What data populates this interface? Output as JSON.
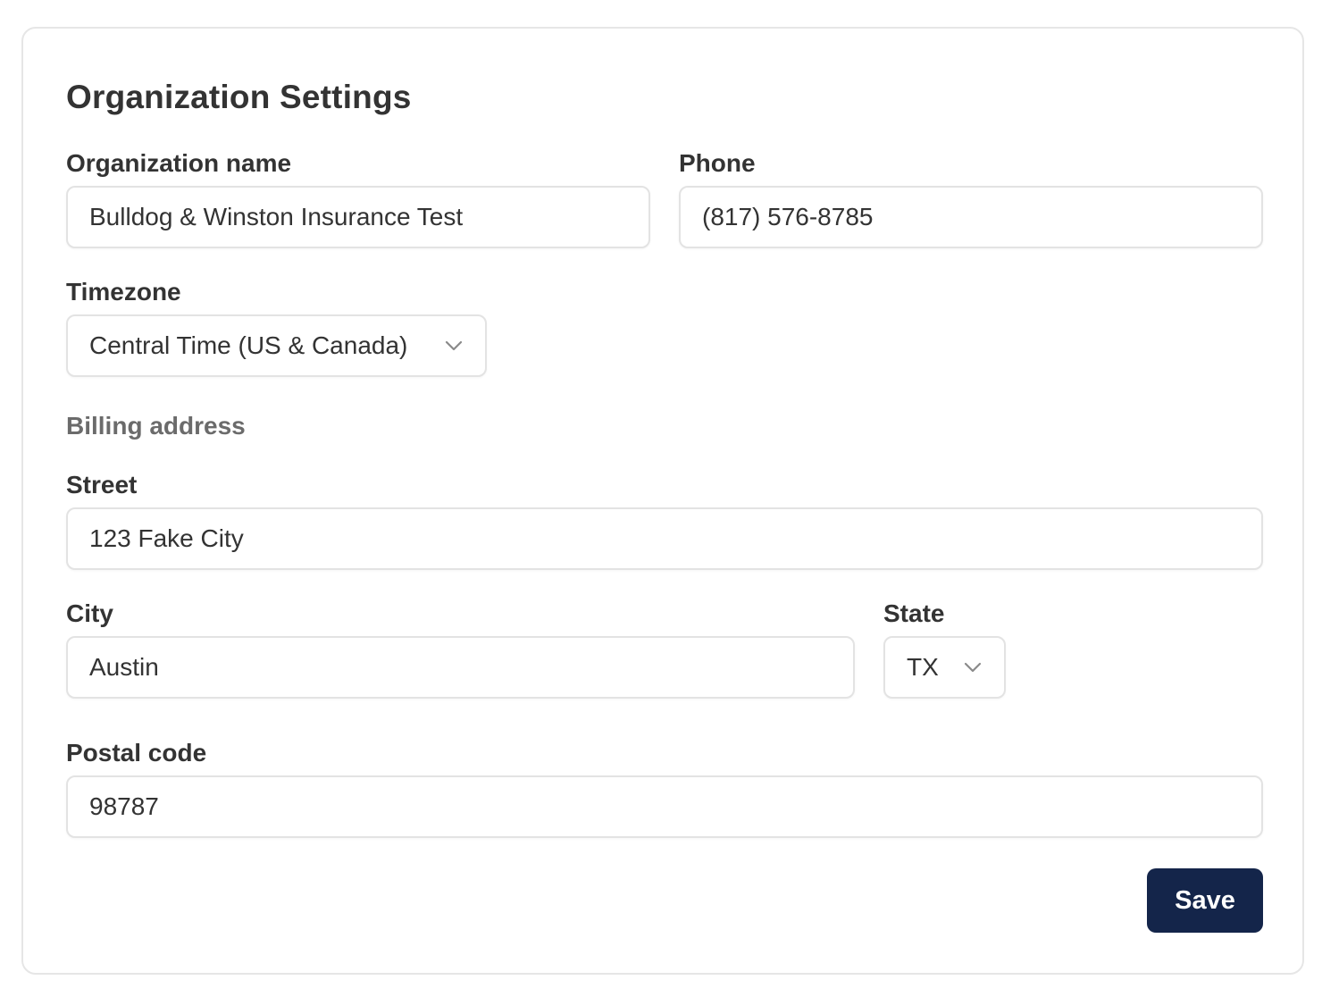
{
  "form": {
    "title": "Organization Settings",
    "organization_name": {
      "label": "Organization name",
      "value": "Bulldog & Winston Insurance Test"
    },
    "phone": {
      "label": "Phone",
      "value": "(817) 576-8785"
    },
    "timezone": {
      "label": "Timezone",
      "selected": "Central Time (US & Canada)",
      "icon": "chevron-down-icon"
    },
    "billing_section_label": "Billing address",
    "street": {
      "label": "Street",
      "value": "123 Fake City"
    },
    "city": {
      "label": "City",
      "value": "Austin"
    },
    "state": {
      "label": "State",
      "selected": "TX",
      "icon": "chevron-down-icon"
    },
    "postal_code": {
      "label": "Postal code",
      "value": "98787"
    },
    "save_label": "Save"
  },
  "colors": {
    "primary_button": "#14254a",
    "border": "#e3e3e3",
    "muted_text": "#6b6b6b"
  }
}
